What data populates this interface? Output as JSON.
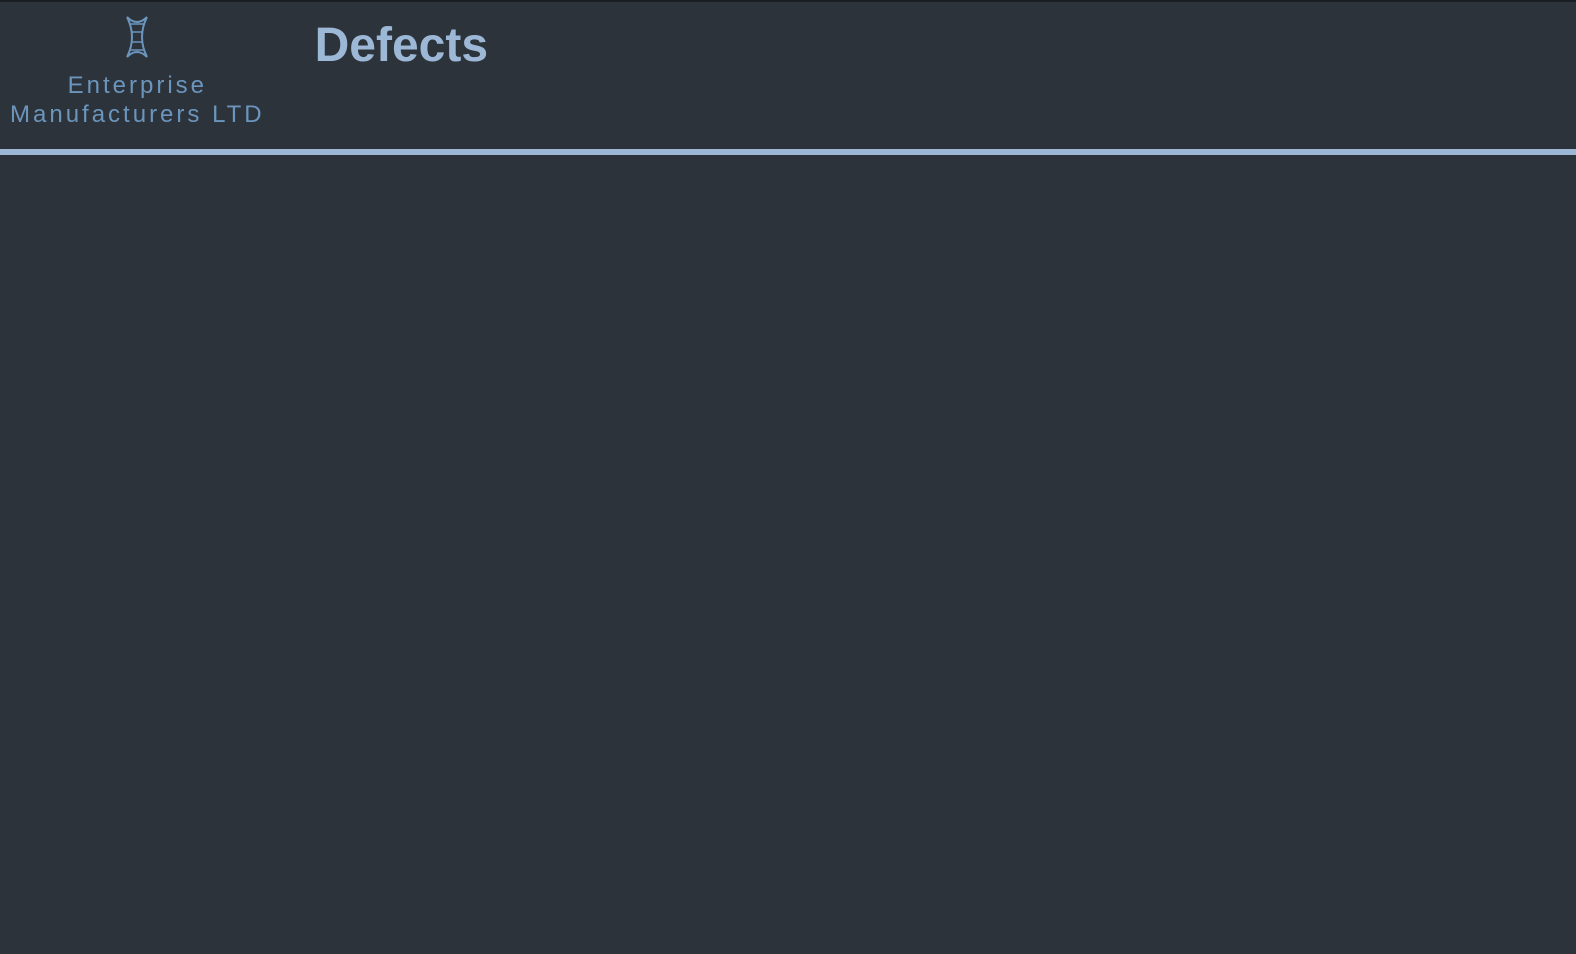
{
  "header": {
    "company_name_line1": "Enterprise",
    "company_name_line2": "Manufacturers LTD",
    "page_title": "Defects"
  }
}
